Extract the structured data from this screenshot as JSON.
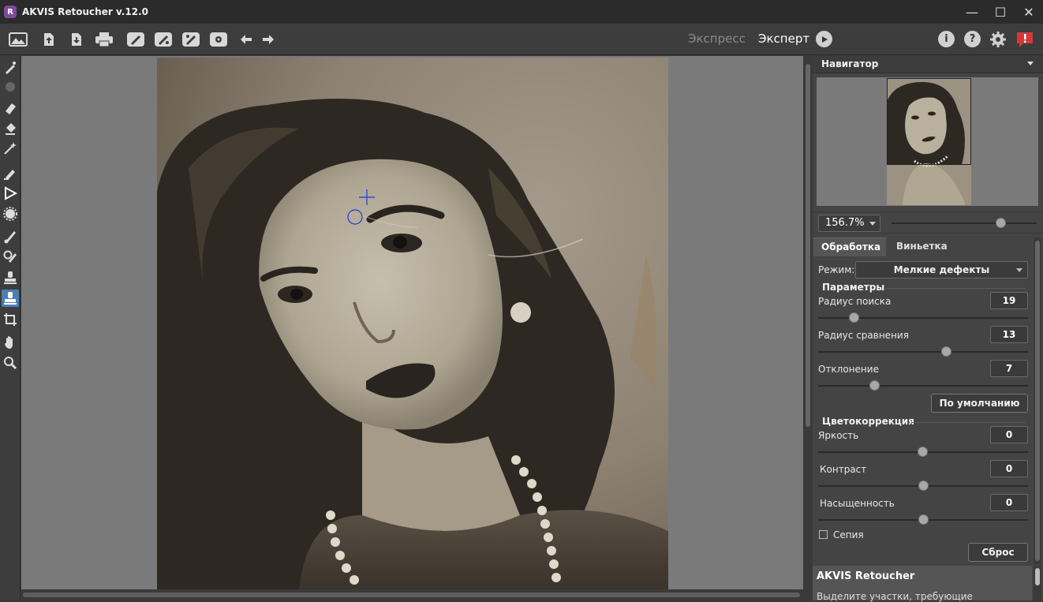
{
  "app": {
    "title": "AKVIS Retoucher v.12.0",
    "logo_letter": "R"
  },
  "window_controls": {
    "minimize": "—",
    "maximize": "☐",
    "close": "✕"
  },
  "toolbar": {
    "buttons": [
      "open-image-icon",
      "load-icon",
      "save-icon",
      "print-icon",
      "brush-preset-1-icon",
      "brush-preset-2-icon",
      "brush-preset-3-icon",
      "settings-gear-icon",
      "undo-icon",
      "redo-icon"
    ],
    "mode_express": "Экспресс",
    "mode_expert": "Эксперт",
    "info_label": "i",
    "help_label": "?"
  },
  "left_tools": [
    "pen-icon",
    "inactive-icon",
    "eraser-icon",
    "bucket-icon",
    "magic-wand-icon",
    "paint-icon",
    "triangle-select-icon",
    "gear-tool-icon",
    "brush-icon",
    "chameleon-brush-icon",
    "clone-stamp-icon",
    "healing-stamp-icon",
    "crop-icon",
    "hand-icon",
    "zoom-icon"
  ],
  "navigator": {
    "title": "Навигатор"
  },
  "zoom": {
    "value": "156.7%",
    "slider": 0.75
  },
  "tabs": {
    "processing": "Обработка",
    "vignette": "Виньетка"
  },
  "settings": {
    "mode_label": "Режим:",
    "mode_value": "Мелкие дефекты",
    "params_title": "Параметры",
    "search_radius_label": "Радиус поиска",
    "search_radius_value": "19",
    "search_radius_slider": 0.17,
    "compare_radius_label": "Радиус сравнения",
    "compare_radius_value": "13",
    "compare_radius_slider": 0.61,
    "deviation_label": "Отклонение",
    "deviation_value": "7",
    "deviation_slider": 0.27,
    "default_button": "По умолчанию",
    "color_title": "Цветокоррекция",
    "brightness_label": "Яркость",
    "brightness_value": "0",
    "contrast_label": "Контраст",
    "contrast_value": "0",
    "saturation_label": "Насыщенность",
    "saturation_value": "0",
    "sepia_label": "Сепия",
    "reset_button": "Сброс"
  },
  "help": {
    "title": "AKVIS Retoucher",
    "text": "Выделите участки, требующие"
  }
}
